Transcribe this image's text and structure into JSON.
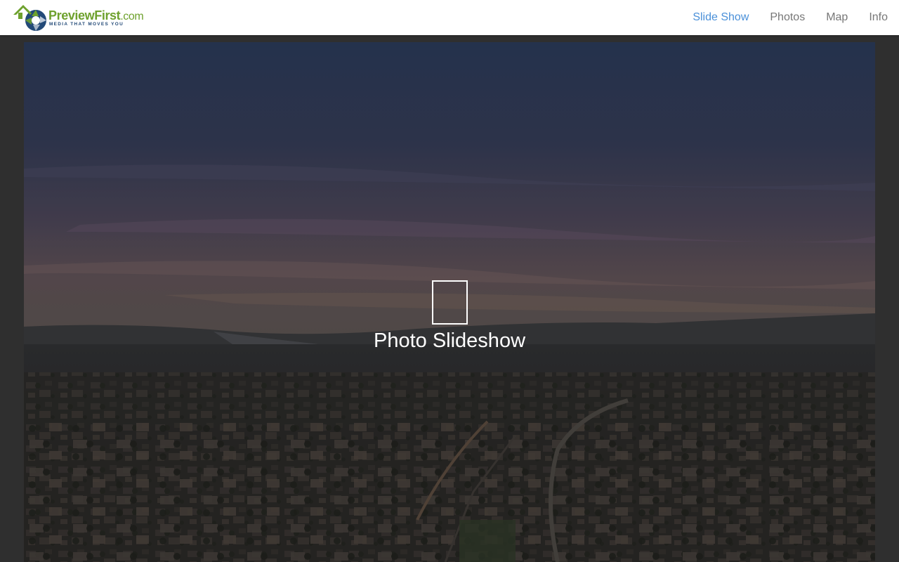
{
  "brand": {
    "name": "PreviewFirst",
    "suffix": ".com",
    "tagline": "MEDIA THAT MOVES YOU",
    "colors": {
      "green": "#6ea12d",
      "navy": "#234a78"
    }
  },
  "nav": {
    "items": [
      {
        "label": "Slide Show",
        "active": true
      },
      {
        "label": "Photos",
        "active": false
      },
      {
        "label": "Map",
        "active": false
      },
      {
        "label": "Info",
        "active": false
      }
    ],
    "active_color": "#4a90d9",
    "inactive_color": "#777777"
  },
  "hero": {
    "icon": "play-icon",
    "label": "Photo Slideshow"
  }
}
